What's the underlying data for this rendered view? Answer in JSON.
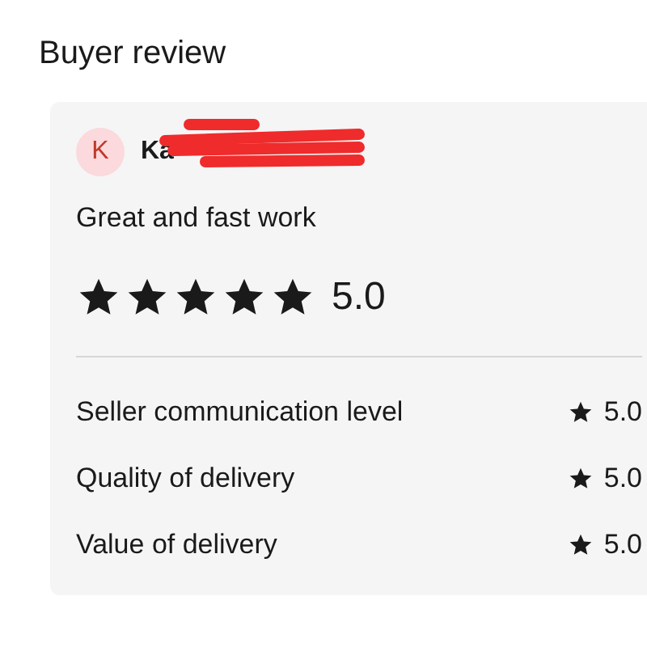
{
  "title": "Buyer review",
  "review": {
    "avatar_initial": "K",
    "name": "Ka",
    "comment": "Great and fast work",
    "stars": 5,
    "score": "5.0",
    "ratings": [
      {
        "label": "Seller communication level",
        "score": "5.0"
      },
      {
        "label": "Quality of delivery",
        "score": "5.0"
      },
      {
        "label": "Value of delivery",
        "score": "5.0"
      }
    ]
  }
}
